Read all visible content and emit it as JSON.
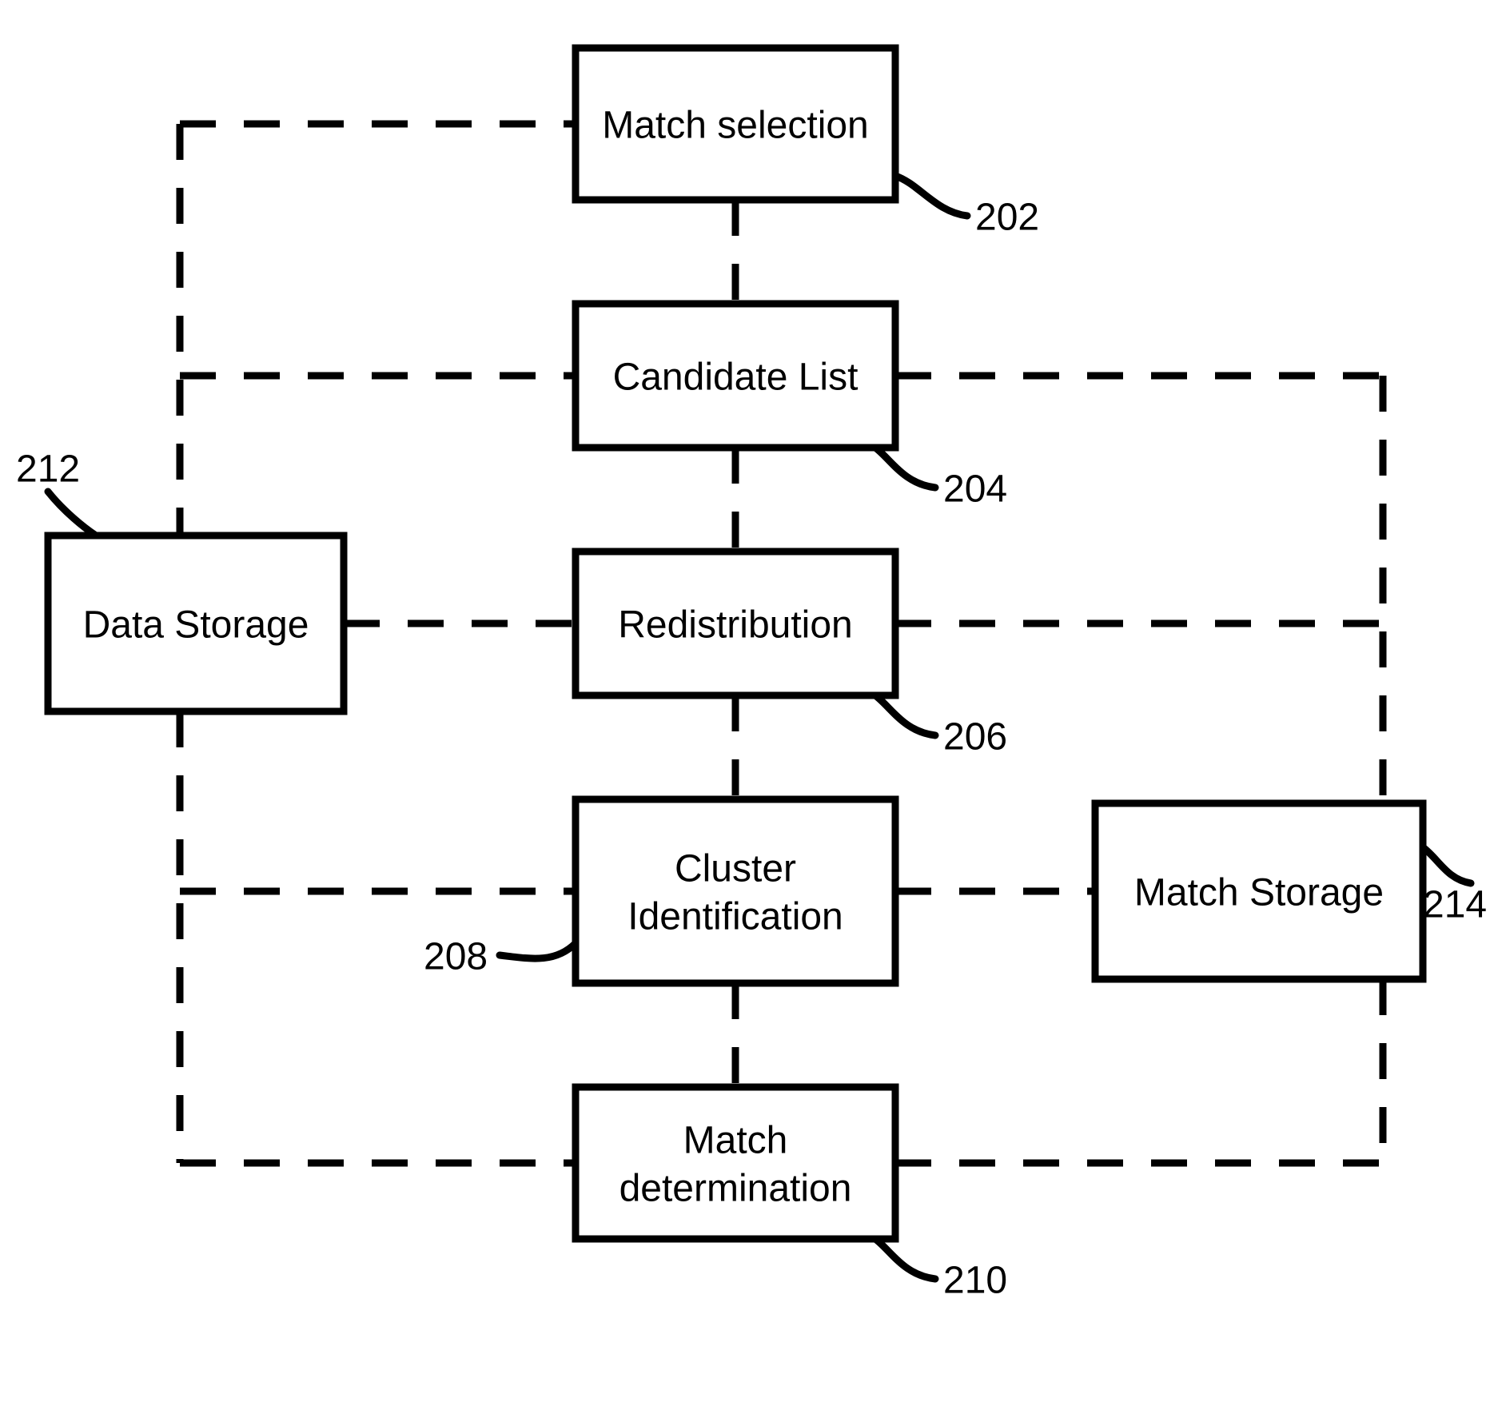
{
  "diagram": {
    "boxes": {
      "match_selection": {
        "label": "Match selection",
        "ref": "202"
      },
      "candidate_list": {
        "label": "Candidate List",
        "ref": "204"
      },
      "redistribution": {
        "label": "Redistribution",
        "ref": "206"
      },
      "cluster_id": {
        "label_line1": "Cluster",
        "label_line2": "Identification",
        "ref": "208"
      },
      "match_determination": {
        "label_line1": "Match",
        "label_line2": "determination",
        "ref": "210"
      },
      "data_storage": {
        "label": "Data Storage",
        "ref": "212"
      },
      "match_storage": {
        "label": "Match Storage",
        "ref": "214"
      }
    }
  }
}
